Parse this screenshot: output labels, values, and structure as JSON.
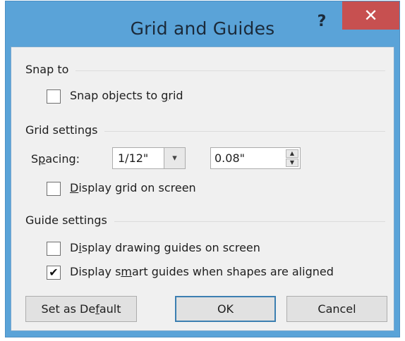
{
  "window": {
    "title": "Grid and Guides",
    "help_label": "?",
    "close_label": "✕"
  },
  "snap": {
    "header": "Snap to",
    "snap_objects": {
      "label_pre": "Snap objects to ",
      "label_key": "g",
      "label_post": "rid",
      "checked": false,
      "mark": ""
    }
  },
  "grid": {
    "header": "Grid settings",
    "spacing_pre": "S",
    "spacing_key": "p",
    "spacing_post": "acing:",
    "spacing_select_value": "1/12\"",
    "spacing_select_arrow": "▾",
    "spacing_value": "0.08\"",
    "spin_up": "▲",
    "spin_down": "▼",
    "display_grid": {
      "label_pre": "",
      "label_key": "D",
      "label_post": "isplay grid on screen",
      "checked": false,
      "mark": ""
    }
  },
  "guides": {
    "header": "Guide settings",
    "drawing_guides": {
      "label_pre": "D",
      "label_key": "i",
      "label_post": "splay drawing guides on screen",
      "checked": false,
      "mark": ""
    },
    "smart_guides": {
      "label_pre": "Display s",
      "label_key": "m",
      "label_post": "art guides when shapes are aligned",
      "checked": true,
      "mark": "✔"
    }
  },
  "buttons": {
    "default_pre": "Set as De",
    "default_key": "f",
    "default_post": "ault",
    "ok": "OK",
    "cancel": "Cancel"
  }
}
